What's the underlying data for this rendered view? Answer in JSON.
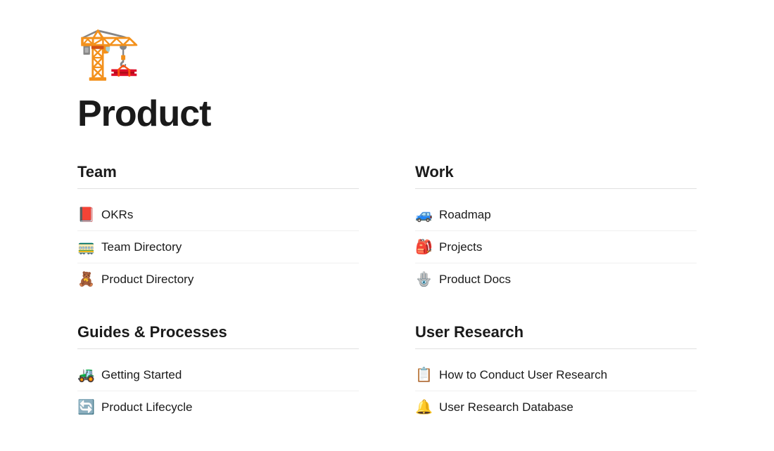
{
  "page": {
    "icon": "🏗️",
    "title": "Product"
  },
  "sections": [
    {
      "id": "team",
      "title": "Team",
      "items": [
        {
          "emoji": "📕",
          "label": "OKRs"
        },
        {
          "emoji": "🚃",
          "label": "Team Directory"
        },
        {
          "emoji": "🧸",
          "label": "Product Directory"
        }
      ]
    },
    {
      "id": "work",
      "title": "Work",
      "items": [
        {
          "emoji": "🚙",
          "label": "Roadmap"
        },
        {
          "emoji": "🎒",
          "label": "Projects"
        },
        {
          "emoji": "🪬",
          "label": "Product Docs"
        }
      ]
    },
    {
      "id": "guides",
      "title": "Guides & Processes",
      "items": [
        {
          "emoji": "🚜",
          "label": "Getting Started"
        },
        {
          "emoji": "🔄",
          "label": "Product Lifecycle"
        }
      ]
    },
    {
      "id": "user-research",
      "title": "User Research",
      "items": [
        {
          "emoji": "📋",
          "label": "How to Conduct User Research"
        },
        {
          "emoji": "🔔",
          "label": "User Research Database"
        }
      ]
    }
  ]
}
